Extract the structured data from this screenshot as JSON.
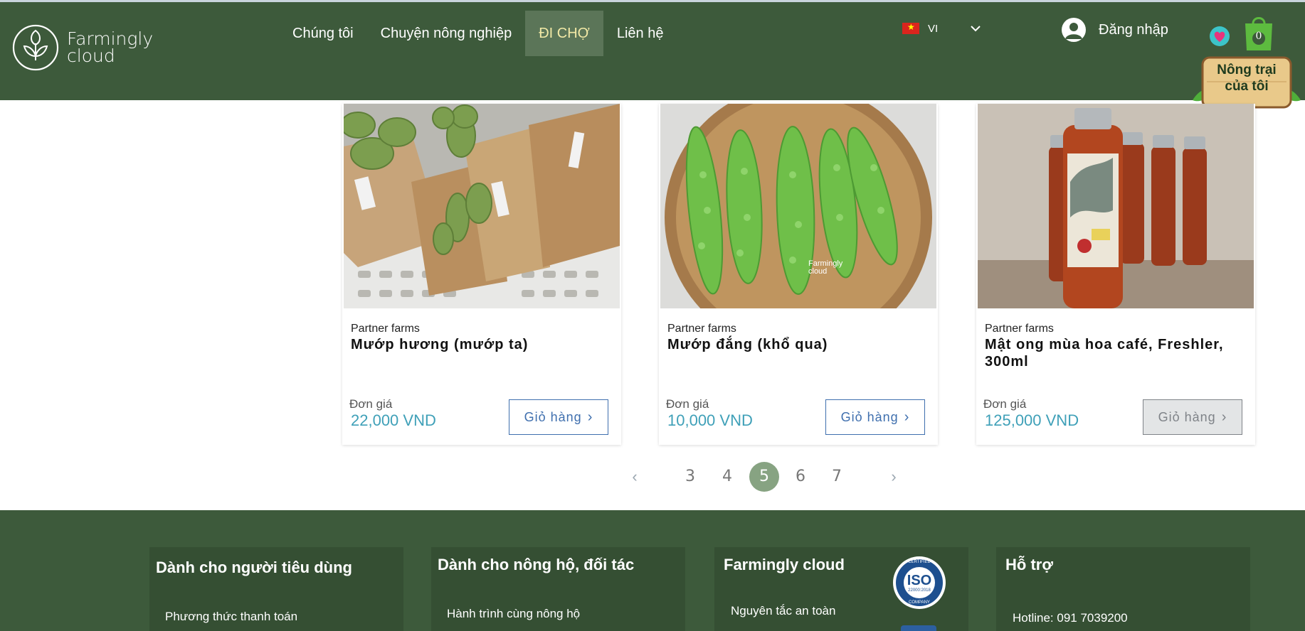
{
  "header": {
    "logo_line1": "Farmingly",
    "logo_line2": "cloud",
    "nav": [
      {
        "label": "Chúng tôi",
        "active": false
      },
      {
        "label": "Chuyện nông nghiệp",
        "active": false
      },
      {
        "label": "ĐI CHỢ",
        "active": true
      },
      {
        "label": "Liên hệ",
        "active": false
      }
    ],
    "language": "VI",
    "login_label": "Đăng nhập",
    "cart_count": "0",
    "farm_badge_line1": "Nông trại",
    "farm_badge_line2": "của tôi"
  },
  "products": [
    {
      "vendor": "Partner farms",
      "name": "Mướp hương (mướp ta)",
      "price_label": "Đơn giá",
      "price": "22,000 VND",
      "button": "Giỏ hàng"
    },
    {
      "vendor": "Partner farms",
      "name": "Mướp đắng (khổ qua)",
      "price_label": "Đơn giá",
      "price": "10,000 VND",
      "button": "Giỏ hàng",
      "image_watermark_1": "Farmingly",
      "image_watermark_2": "cloud"
    },
    {
      "vendor": "Partner farms",
      "name": "Mật ong mùa hoa café, Freshler, 300ml",
      "price_label": "Đơn giá",
      "price": "125,000 VND",
      "button": "Giỏ hàng"
    }
  ],
  "pagination": {
    "pages": [
      "3",
      "4",
      "5",
      "6",
      "7"
    ],
    "current": "5"
  },
  "footer": {
    "columns": [
      {
        "title": "Dành cho người tiêu dùng",
        "link": "Phương thức thanh toán"
      },
      {
        "title": "Dành cho nông hộ, đối tác",
        "link": "Hành trình cùng nông hộ"
      },
      {
        "title": "Farmingly cloud",
        "link": "Nguyên tắc an toàn"
      },
      {
        "title": "Hỗ trợ",
        "link": "Hotline: 091 7039200"
      }
    ],
    "iso_top": "CERTIFIED",
    "iso_label": "ISO",
    "iso_standard": "22000:2018",
    "iso_bottom": "COMPANY"
  },
  "colors": {
    "header_bg": "#3d5a3b",
    "active_nav_bg": "#5b7558",
    "price": "#3fa0b8",
    "button": "#3f6fae",
    "page_active": "#87a382"
  }
}
